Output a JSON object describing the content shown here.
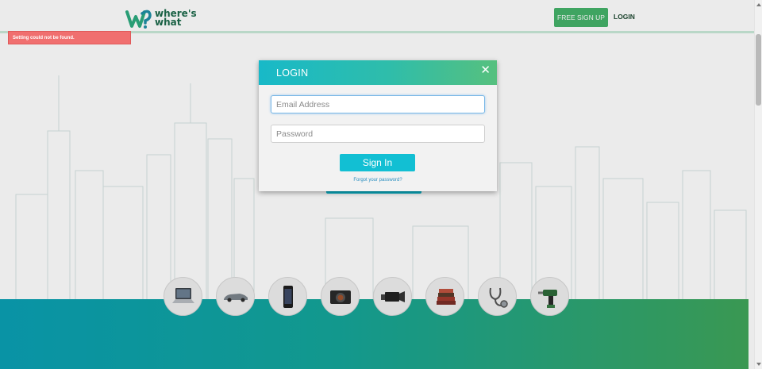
{
  "header": {
    "logo_line1": "where's",
    "logo_line2": "what",
    "signup_label": "FREE SIGN UP",
    "login_label": "LOGIN"
  },
  "alert": {
    "message": "Setting could not be found."
  },
  "modal": {
    "title": "LOGIN",
    "close_glyph": "✕",
    "email_placeholder": "Email Address",
    "password_placeholder": "Password",
    "signin_label": "Sign In",
    "forgot_label": "Forgot your password?"
  },
  "categories": [
    {
      "icon": "laptop-icon"
    },
    {
      "icon": "car-icon"
    },
    {
      "icon": "phone-icon"
    },
    {
      "icon": "camera-icon"
    },
    {
      "icon": "camcorder-icon"
    },
    {
      "icon": "books-icon"
    },
    {
      "icon": "stethoscope-icon"
    },
    {
      "icon": "drill-icon"
    }
  ],
  "colors": {
    "brand_green": "#45b26a",
    "brand_teal": "#12bfd3",
    "alert_red": "#f06f6f"
  }
}
